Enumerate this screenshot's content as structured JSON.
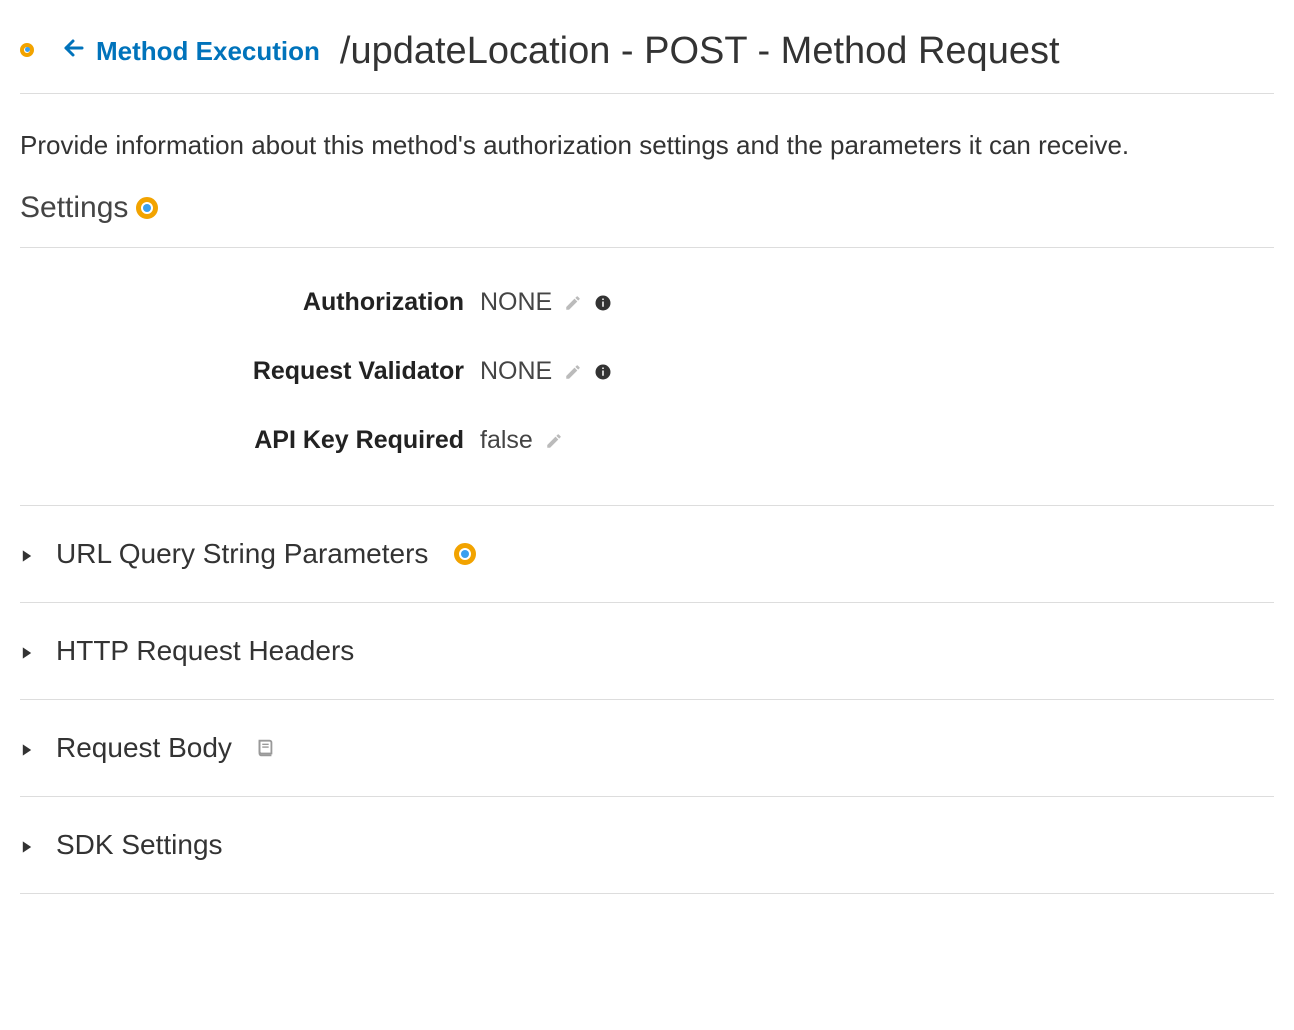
{
  "header": {
    "back_link_label": "Method Execution",
    "page_title": "/updateLocation - POST - Method Request"
  },
  "description": "Provide information about this method's authorization settings and the parameters it can receive.",
  "sections": {
    "settings": {
      "title": "Settings",
      "rows": [
        {
          "label": "Authorization",
          "value": "NONE",
          "has_edit": true,
          "has_info": true
        },
        {
          "label": "Request Validator",
          "value": "NONE",
          "has_edit": true,
          "has_info": true
        },
        {
          "label": "API Key Required",
          "value": "false",
          "has_edit": true,
          "has_info": false
        }
      ]
    },
    "collapsibles": [
      {
        "title": "URL Query String Parameters",
        "has_badge": true,
        "has_book": false
      },
      {
        "title": "HTTP Request Headers",
        "has_badge": false,
        "has_book": false
      },
      {
        "title": "Request Body",
        "has_badge": false,
        "has_book": true
      },
      {
        "title": "SDK Settings",
        "has_badge": false,
        "has_book": false
      }
    ]
  },
  "colors": {
    "link": "#0073bb",
    "badge_outer": "#f2a300",
    "badge_inner": "#3a9ff0"
  }
}
